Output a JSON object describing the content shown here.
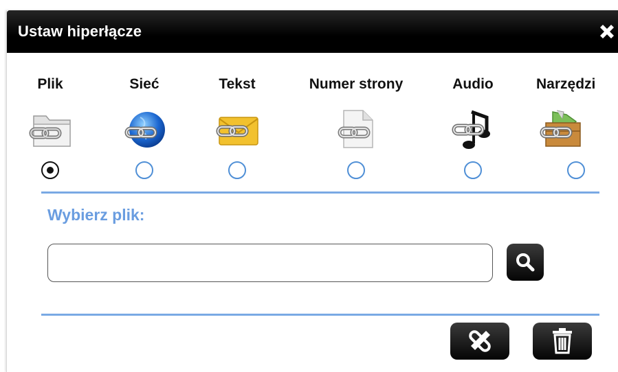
{
  "dialog": {
    "title": "Ustaw hiperłącze"
  },
  "tabs": [
    {
      "label": "Plik",
      "icon": "folder-link-icon",
      "selected": true
    },
    {
      "label": "Sieć",
      "icon": "globe-link-icon",
      "selected": false
    },
    {
      "label": "Tekst",
      "icon": "envelope-link-icon",
      "selected": false
    },
    {
      "label": "Numer strony",
      "icon": "page-link-icon",
      "selected": false
    },
    {
      "label": "Audio",
      "icon": "music-link-icon",
      "selected": false
    },
    {
      "label": "Narzędzi",
      "icon": "toolbox-link-icon",
      "selected": false
    }
  ],
  "file": {
    "label": "Wybierz plik:",
    "value": "",
    "placeholder": ""
  },
  "colors": {
    "accent": "#6a9de0",
    "divider": "#79a9e4",
    "radio": "#4f8fd6",
    "titlebar": "#000000"
  }
}
